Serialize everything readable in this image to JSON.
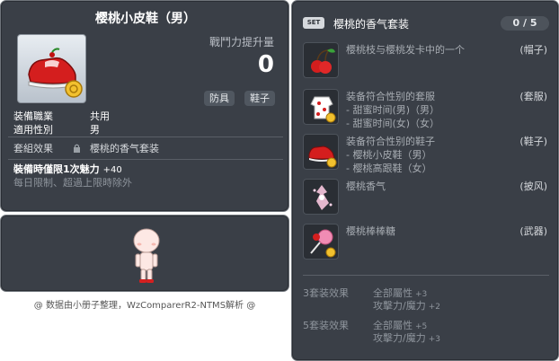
{
  "item_id": "01070088",
  "item": {
    "name": "樱桃小皮鞋（男）",
    "power_label": "戰鬥力提升量",
    "power_value": "0",
    "tags": [
      "防具",
      "鞋子"
    ],
    "job_label": "装備職業",
    "job_value": "共用",
    "gender_label": "適用性別",
    "gender_value": "男",
    "set_label": "套組效果",
    "set_value": "樱桃的香气套装",
    "charm_label": "裝備時僅限1次魅力",
    "charm_value": "+40",
    "limit_text": "每日限制、超過上限時除外"
  },
  "footer": "@ 数据由小册子整理，WzComparerR2-NTMS解析 @",
  "set": {
    "badge": "SET",
    "title": "樱桃的香气套装",
    "count": "0 / 5",
    "items": [
      {
        "name": "樱桃枝与樱桃发卡中的一个",
        "slot": "(帽子)",
        "subs": [],
        "icon": "cherry-hat-icon"
      },
      {
        "name": "装备符合性别的套服",
        "slot": "(套服)",
        "subs": [
          "- 甜蜜时间(男)（男）",
          "- 甜蜜时间(女)（女）"
        ],
        "icon": "overall-icon"
      },
      {
        "name": "装备符合性别的鞋子",
        "slot": "(鞋子)",
        "subs": [
          "- 樱桃小皮鞋（男）",
          "- 樱桃高跟鞋（女）"
        ],
        "icon": "shoes-icon"
      },
      {
        "name": "樱桃香气",
        "slot": "(披风)",
        "subs": [],
        "icon": "cape-icon"
      },
      {
        "name": "樱桃棒棒糖",
        "slot": "(武器)",
        "subs": [],
        "icon": "lollipop-icon"
      }
    ],
    "bonuses": [
      {
        "label": "3套装效果",
        "lines": [
          {
            "text": "全部屬性",
            "value": "+3"
          },
          {
            "text": "攻擊力/魔力",
            "value": "+2"
          }
        ]
      },
      {
        "label": "5套装效果",
        "lines": [
          {
            "text": "全部屬性",
            "value": "+5"
          },
          {
            "text": "攻擊力/魔力",
            "value": "+3"
          }
        ]
      }
    ]
  }
}
